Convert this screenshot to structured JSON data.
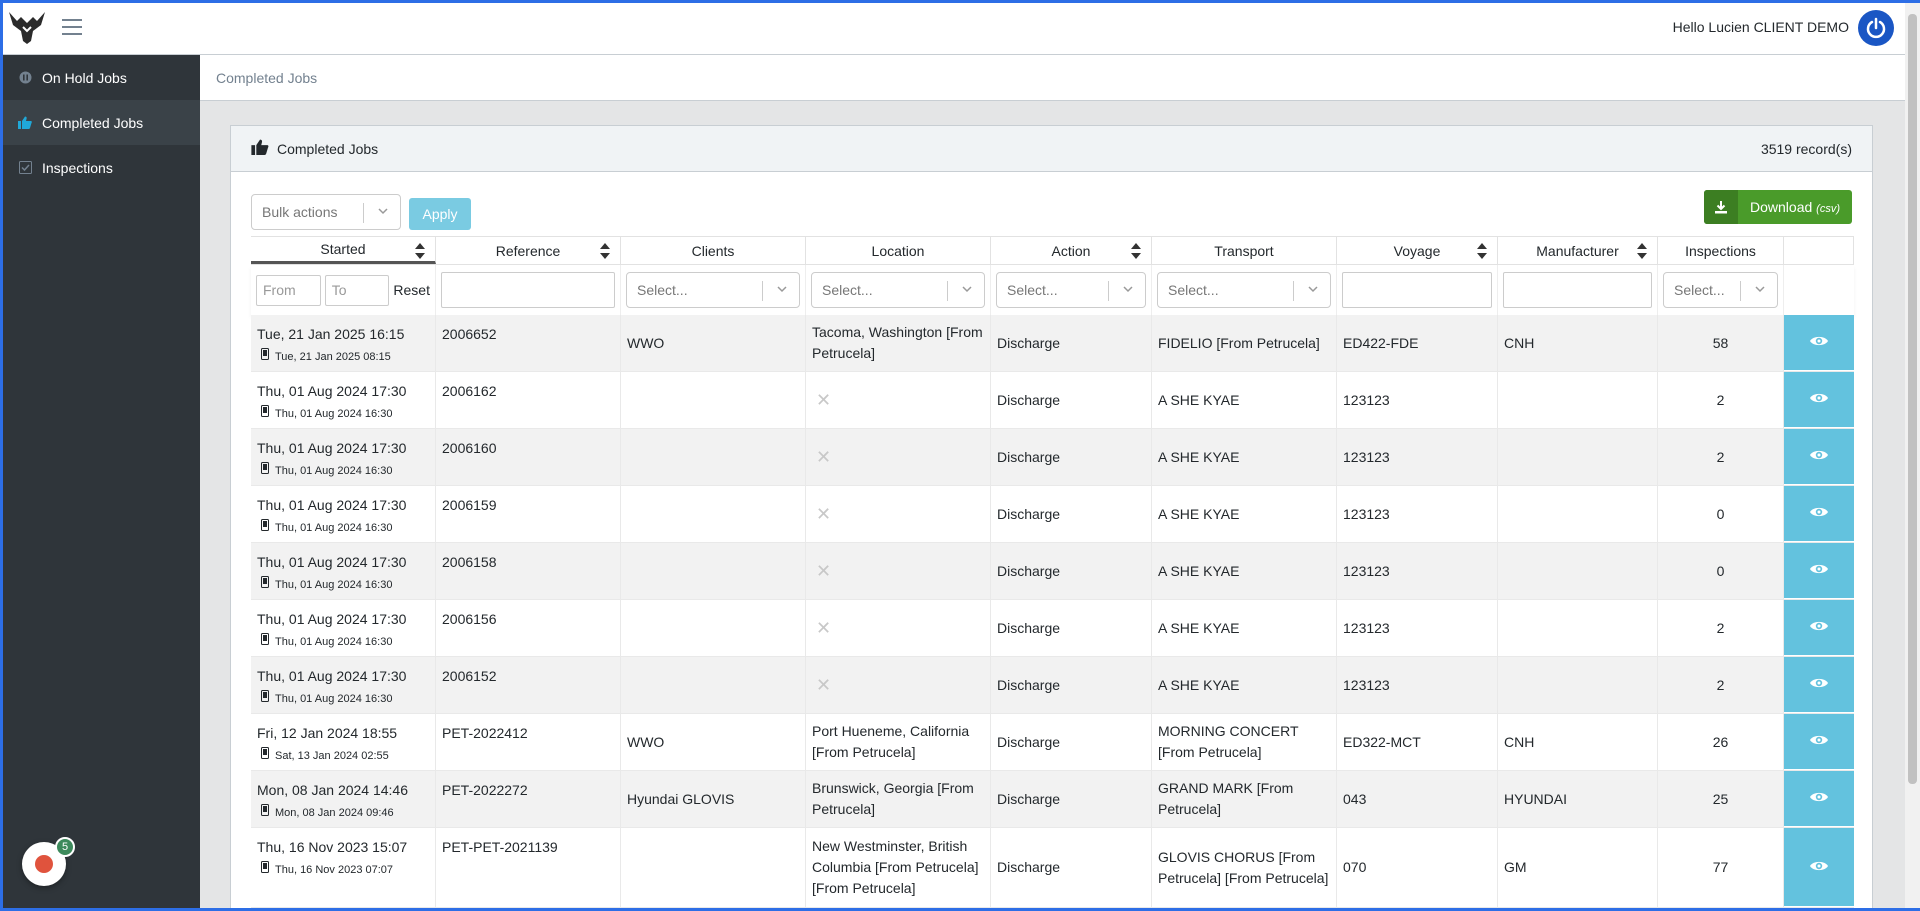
{
  "header": {
    "greeting": "Hello Lucien CLIENT DEMO",
    "logo_icon": "bull-logo-icon",
    "menu_icon": "hamburger-icon",
    "power_icon": "power-icon"
  },
  "sidebar": {
    "items": [
      {
        "label": "On Hold Jobs",
        "icon": "pause-icon",
        "active": false
      },
      {
        "label": "Completed Jobs",
        "icon": "thumbs-up-icon",
        "active": true
      },
      {
        "label": "Inspections",
        "icon": "check-square-icon",
        "active": false
      }
    ]
  },
  "breadcrumb": "Completed Jobs",
  "card": {
    "title": "Completed Jobs",
    "records": "3519 record(s)",
    "bulk_placeholder": "Bulk actions",
    "apply_label": "Apply",
    "download_label": "Download",
    "download_suffix": "(csv)"
  },
  "columns": {
    "started": "Started",
    "reference": "Reference",
    "clients": "Clients",
    "location": "Location",
    "action": "Action",
    "transport": "Transport",
    "voyage": "Voyage",
    "manufacturer": "Manufacturer",
    "inspections": "Inspections"
  },
  "filters": {
    "from": "From",
    "to": "To",
    "reset": "Reset",
    "select": "Select..."
  },
  "rows": [
    {
      "started": "Tue, 21 Jan 2025 16:15",
      "device_date": "Tue, 21 Jan 2025 08:15",
      "reference": "2006652",
      "clients": "WWO",
      "location": "Tacoma, Washington [From Petrucela]",
      "action": "Discharge",
      "transport": "FIDELIO [From Petrucela]",
      "voyage": "ED422-FDE",
      "manufacturer": "CNH",
      "inspections": "58"
    },
    {
      "started": "Thu, 01 Aug 2024 17:30",
      "device_date": "Thu, 01 Aug 2024 16:30",
      "reference": "2006162",
      "clients": "",
      "location": "",
      "action": "Discharge",
      "transport": "A SHE KYAE",
      "voyage": "123123",
      "manufacturer": "",
      "inspections": "2"
    },
    {
      "started": "Thu, 01 Aug 2024 17:30",
      "device_date": "Thu, 01 Aug 2024 16:30",
      "reference": "2006160",
      "clients": "",
      "location": "",
      "action": "Discharge",
      "transport": "A SHE KYAE",
      "voyage": "123123",
      "manufacturer": "",
      "inspections": "2"
    },
    {
      "started": "Thu, 01 Aug 2024 17:30",
      "device_date": "Thu, 01 Aug 2024 16:30",
      "reference": "2006159",
      "clients": "",
      "location": "",
      "action": "Discharge",
      "transport": "A SHE KYAE",
      "voyage": "123123",
      "manufacturer": "",
      "inspections": "0"
    },
    {
      "started": "Thu, 01 Aug 2024 17:30",
      "device_date": "Thu, 01 Aug 2024 16:30",
      "reference": "2006158",
      "clients": "",
      "location": "",
      "action": "Discharge",
      "transport": "A SHE KYAE",
      "voyage": "123123",
      "manufacturer": "",
      "inspections": "0"
    },
    {
      "started": "Thu, 01 Aug 2024 17:30",
      "device_date": "Thu, 01 Aug 2024 16:30",
      "reference": "2006156",
      "clients": "",
      "location": "",
      "action": "Discharge",
      "transport": "A SHE KYAE",
      "voyage": "123123",
      "manufacturer": "",
      "inspections": "2"
    },
    {
      "started": "Thu, 01 Aug 2024 17:30",
      "device_date": "Thu, 01 Aug 2024 16:30",
      "reference": "2006152",
      "clients": "",
      "location": "",
      "action": "Discharge",
      "transport": "A SHE KYAE",
      "voyage": "123123",
      "manufacturer": "",
      "inspections": "2"
    },
    {
      "started": "Fri, 12 Jan 2024 18:55",
      "device_date": "Sat, 13 Jan 2024 02:55",
      "reference": "PET-2022412",
      "clients": "WWO",
      "location": "Port Hueneme, California [From Petrucela]",
      "action": "Discharge",
      "transport": "MORNING CONCERT [From Petrucela]",
      "voyage": "ED322-MCT",
      "manufacturer": "CNH",
      "inspections": "26"
    },
    {
      "started": "Mon, 08 Jan 2024 14:46",
      "device_date": "Mon, 08 Jan 2024 09:46",
      "reference": "PET-2022272",
      "clients": "Hyundai GLOVIS",
      "location": "Brunswick, Georgia [From Petrucela]",
      "action": "Discharge",
      "transport": "GRAND MARK [From Petrucela]",
      "voyage": "043",
      "manufacturer": "HYUNDAI",
      "inspections": "25"
    },
    {
      "started": "Thu, 16 Nov 2023 15:07",
      "device_date": "Thu, 16 Nov 2023 07:07",
      "reference": "PET-PET-2021139",
      "clients": "",
      "location": "New Westminster, British Columbia [From Petrucela] [From Petrucela]",
      "action": "Discharge",
      "transport": "GLOVIS CHORUS [From Petrucela] [From Petrucela]",
      "voyage": "070",
      "manufacturer": "GM",
      "inspections": "77"
    }
  ],
  "notification": {
    "count": "5"
  }
}
